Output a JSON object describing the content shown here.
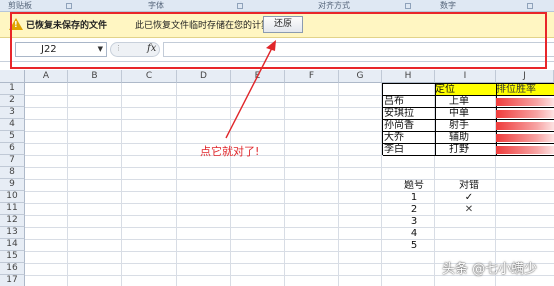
{
  "ribbon": {
    "groups": [
      "剪贴板",
      "字体",
      "对齐方式",
      "数字"
    ]
  },
  "message_bar": {
    "title": "已恢复未保存的文件",
    "text": "此已恢复文件临时存储在您的计算机中。",
    "restore_label": "还原",
    "bg_color": "#fff6c2",
    "icon": "warning-icon"
  },
  "formula_bar": {
    "name_box": "J22",
    "fx_label": "fx",
    "formula": ""
  },
  "grid": {
    "columns": [
      "A",
      "B",
      "C",
      "D",
      "E",
      "F",
      "G",
      "H",
      "I",
      "J"
    ],
    "rows": [
      "1",
      "2",
      "3",
      "4",
      "5",
      "6",
      "7",
      "8",
      "9",
      "10",
      "11",
      "12",
      "13",
      "14",
      "15",
      "16",
      "17"
    ]
  },
  "table": {
    "headers": [
      "",
      "定位",
      "排位胜率"
    ],
    "rows": [
      {
        "name": "吕布",
        "role": "上单"
      },
      {
        "name": "安琪拉",
        "role": "中单"
      },
      {
        "name": "孙尚香",
        "role": "射手"
      },
      {
        "name": "大乔",
        "role": "辅助"
      },
      {
        "name": "李白",
        "role": "打野"
      }
    ],
    "header_color": "#ffff00",
    "bar_color": "#ef3b3b"
  },
  "quiz": {
    "header_number": "题号",
    "header_result": "对错",
    "numbers": [
      "1",
      "2",
      "3",
      "4",
      "5"
    ],
    "results": [
      "✓",
      "✕",
      "",
      "",
      ""
    ]
  },
  "annotation": {
    "text": "点它就对了!",
    "color": "#e0262a"
  },
  "watermark": "头条 @七小螨少"
}
